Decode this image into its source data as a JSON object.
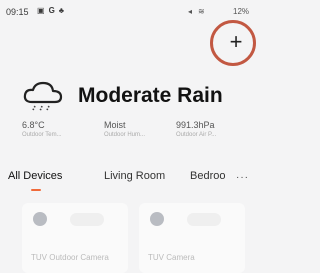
{
  "status_bar": {
    "time": "09:15",
    "left_icons": [
      "mail-icon",
      "google-icon",
      "app-icon"
    ],
    "right_icons": [
      "mute-icon",
      "wifi-icon"
    ],
    "battery": "12%"
  },
  "header": {
    "add_label": "+"
  },
  "weather": {
    "condition": "Moderate Rain",
    "icon": "rain-cloud-icon",
    "metrics": [
      {
        "value": "6.8°C",
        "label": "Outdoor Tem..."
      },
      {
        "value": "Moist",
        "label": "Outdoor Hum..."
      },
      {
        "value": "991.3hPa",
        "label": "Outdoor Air P..."
      }
    ]
  },
  "tabs": {
    "items": [
      "All Devices",
      "Living Room",
      "Bedroo"
    ],
    "active": "All Devices",
    "more": "···"
  },
  "devices": [
    {
      "name": "TUV Outdoor Camera"
    },
    {
      "name": "TUV Camera"
    }
  ],
  "colors": {
    "accent": "#f06a3a",
    "annotation_circle": "#c25842"
  }
}
